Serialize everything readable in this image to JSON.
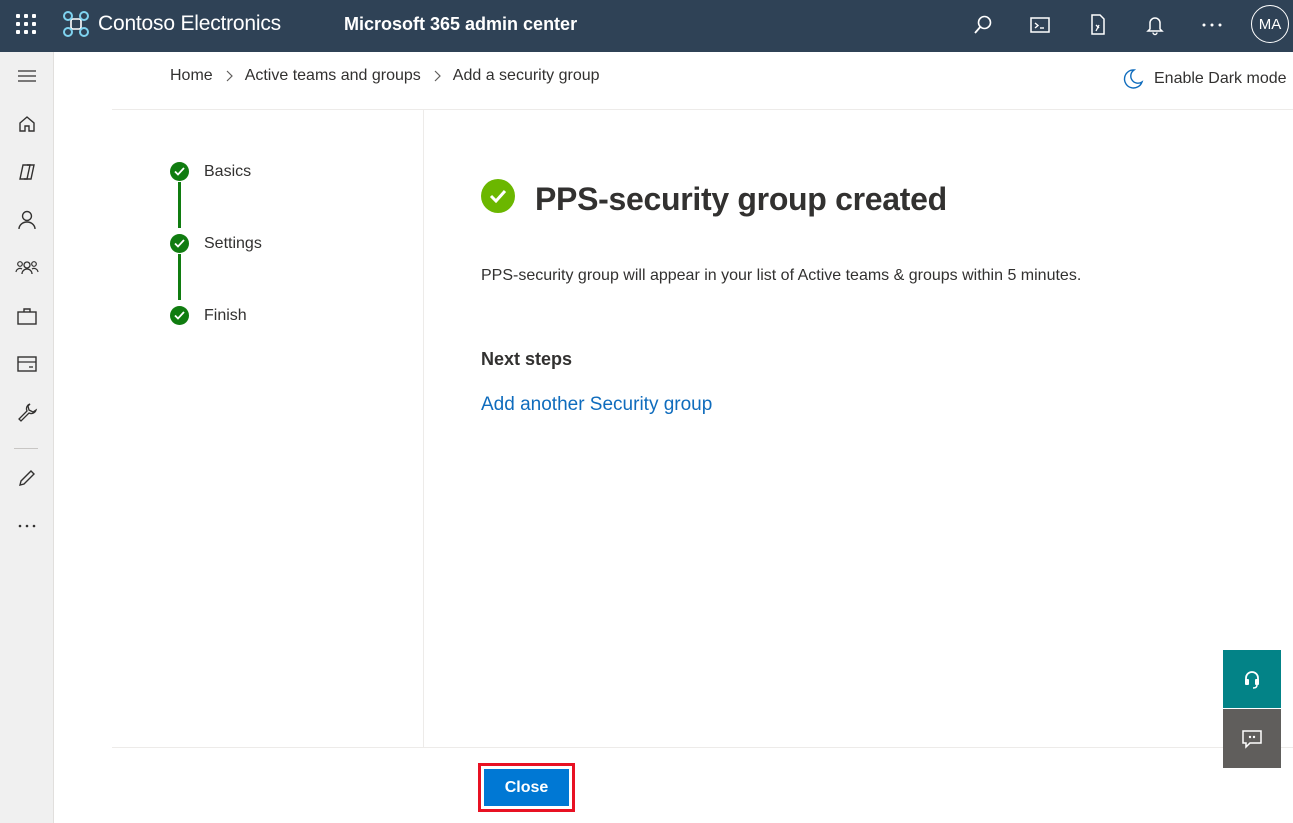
{
  "topbar": {
    "org_name": "Contoso Electronics",
    "app_title": "Microsoft 365 admin center",
    "avatar_initials": "MA",
    "icons": [
      "app-launcher-icon",
      "search-icon",
      "terminal-icon",
      "mobile-app-icon",
      "notification-bell-icon",
      "more-options-icon"
    ]
  },
  "navrail": {
    "icons": [
      "menu-icon",
      "home-icon",
      "copilot-icon",
      "users-icon",
      "teams-groups-icon",
      "roles-icon",
      "billing-icon",
      "setup-icon",
      "customize-icon",
      "more-icon"
    ]
  },
  "breadcrumb": {
    "items": [
      "Home",
      "Active teams and groups",
      "Add a security group"
    ]
  },
  "dark_mode_label": "Enable Dark mode",
  "steps": [
    {
      "label": "Basics"
    },
    {
      "label": "Settings"
    },
    {
      "label": "Finish"
    }
  ],
  "main": {
    "title": "PPS-security group created",
    "description": "PPS-security group will appear in your list of Active teams & groups within 5 minutes.",
    "next_steps_heading": "Next steps",
    "link_label": "Add another Security group"
  },
  "footer": {
    "close_label": "Close"
  },
  "colors": {
    "topbar": "#2f4256",
    "step_complete": "#107c10",
    "success": "#6bb700",
    "primary_button": "#0078d4",
    "link": "#0f6cbd",
    "highlight": "#e81123"
  }
}
